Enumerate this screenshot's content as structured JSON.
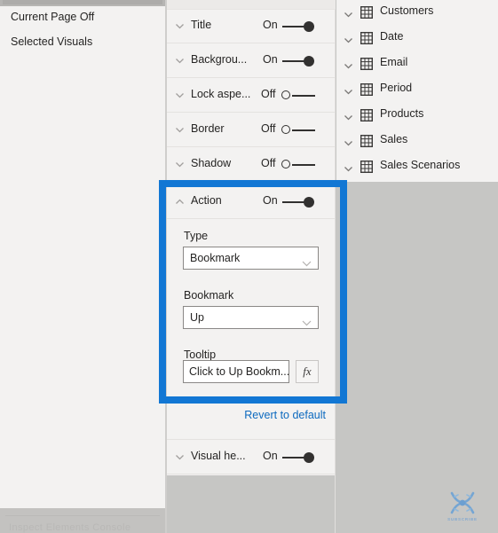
{
  "left_panel": {
    "items": [
      {
        "label": "Current Page Off"
      },
      {
        "label": "Selected Visuals"
      }
    ],
    "bottom_ghost_label": "Inspect  Elements  Console"
  },
  "format_panel": {
    "rows": [
      {
        "name": "Title",
        "label": "Title",
        "state": "On",
        "toggle": "on"
      },
      {
        "name": "Background",
        "label": "Backgrou...",
        "state": "On",
        "toggle": "on"
      },
      {
        "name": "Lock aspect",
        "label": "Lock aspe...",
        "state": "Off",
        "toggle": "off"
      },
      {
        "name": "Border",
        "label": "Border",
        "state": "Off",
        "toggle": "off"
      },
      {
        "name": "Shadow",
        "label": "Shadow",
        "state": "Off",
        "toggle": "off"
      }
    ],
    "action_section": {
      "label": "Action",
      "state": "On",
      "toggle": "on",
      "type_label": "Type",
      "type_value": "Bookmark",
      "bookmark_label": "Bookmark",
      "bookmark_value": "Up",
      "tooltip_label": "Tooltip",
      "tooltip_value": "Click to Up Bookm...",
      "fx_label": "fx",
      "highlight_color": "#1277d4"
    },
    "revert_label": "Revert to default",
    "visual_header": {
      "label": "Visual he...",
      "state": "On",
      "toggle": "on"
    }
  },
  "fields_panel": {
    "items": [
      {
        "label": "Customers"
      },
      {
        "label": "Date"
      },
      {
        "label": "Email"
      },
      {
        "label": "Period"
      },
      {
        "label": "Products"
      },
      {
        "label": "Sales"
      },
      {
        "label": "Sales Scenarios"
      }
    ]
  },
  "watermark": {
    "text": "SUBSCRIBE",
    "color": "#6c9fd4"
  }
}
